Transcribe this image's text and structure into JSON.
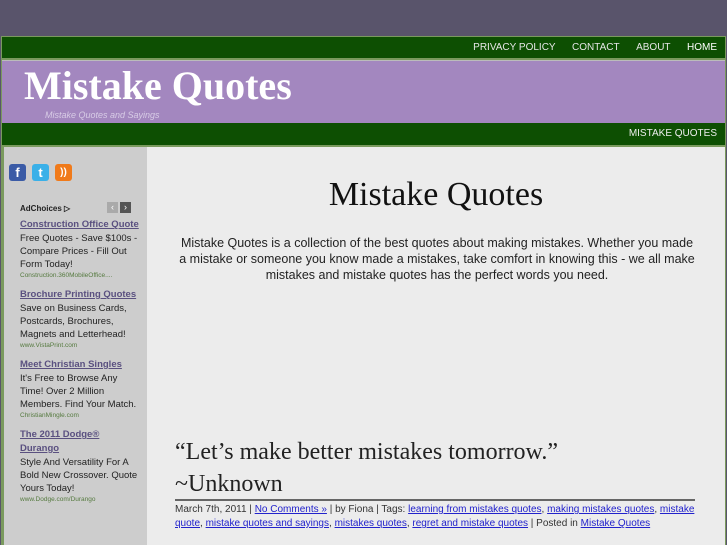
{
  "nav": {
    "items": [
      "PRIVACY POLICY",
      "CONTACT",
      "ABOUT",
      "HOME"
    ]
  },
  "header": {
    "title": "Mistake Quotes",
    "tagline": "Mistake Quotes and Sayings"
  },
  "category_nav": {
    "item": "MISTAKE QUOTES"
  },
  "sidebar": {
    "social": [
      "facebook-icon",
      "twitter-icon",
      "rss-icon"
    ],
    "adchoices": "AdChoices",
    "ads": [
      {
        "title": "Construction Office Quote",
        "text": "Free Quotes - Save $100s - Compare Prices - Fill Out Form Today!",
        "url": "Construction.360MobileOffice...."
      },
      {
        "title": "Brochure Printing Quotes",
        "text": "Save on Business Cards, Postcards, Brochures, Magnets and Letterhead!",
        "url": "www.VistaPrint.com"
      },
      {
        "title": "Meet Christian Singles",
        "text": "It's Free to Browse Any Time! Over 2 Million Members. Find Your Match.",
        "url": "ChristianMingle.com"
      },
      {
        "title": "The 2011 Dodge® Durango",
        "text": "Style And Versatility For A Bold New Crossover. Quote Yours Today!",
        "url": "www.Dodge.com/Durango"
      }
    ]
  },
  "main": {
    "title": "Mistake Quotes",
    "intro": "Mistake Quotes is a collection of the best quotes about making mistakes. Whether you made a mistake or someone you know made a mistakes, take comfort in knowing this - we all make mistakes and mistake quotes has the perfect words you need.",
    "post": {
      "quote": "“Let’s make better mistakes tomorrow.”",
      "author": "~Unknown",
      "date": "March 7th, 2011 | ",
      "comments": "No Comments »",
      "by": " | by Fiona | Tags: ",
      "tags": [
        "learning from mistakes quotes",
        "making mistakes quotes",
        "mistake quote",
        "mistake quotes and sayings",
        "mistakes quotes",
        "regret and mistake quotes"
      ],
      "posted_in": " | Posted in ",
      "category": "Mistake Quotes"
    }
  }
}
